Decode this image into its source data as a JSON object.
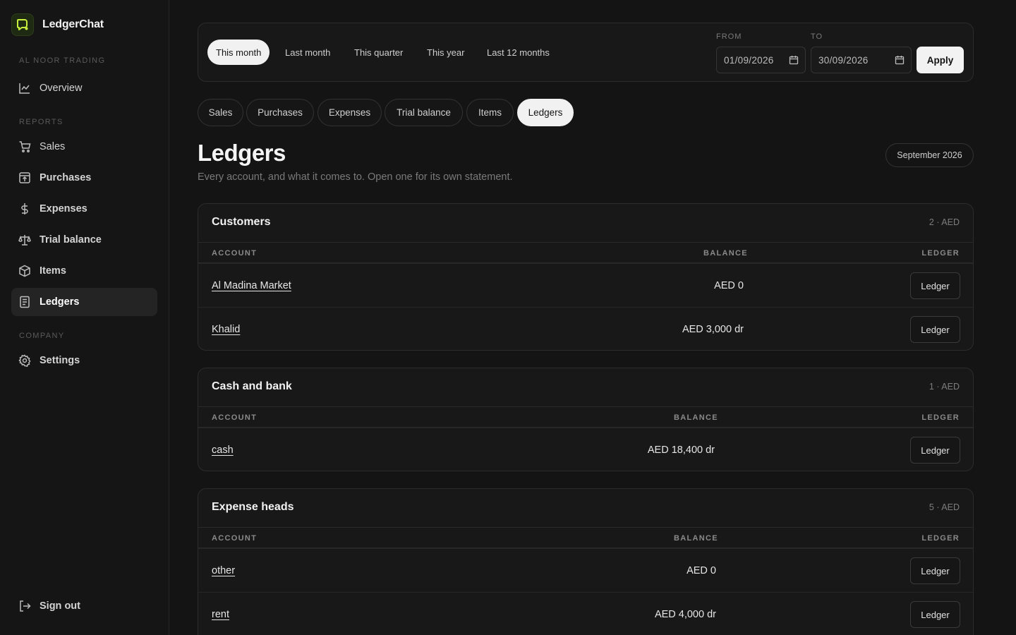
{
  "brand": {
    "name": "LedgerChat"
  },
  "sidebar": {
    "company_label": "AL NOOR TRADING",
    "overview_label": "Overview",
    "reports_label": "REPORTS",
    "reports": [
      {
        "label": "Sales",
        "icon": "cart-icon"
      },
      {
        "label": "Purchases",
        "icon": "box-arrow-icon"
      },
      {
        "label": "Expenses",
        "icon": "dollar-icon"
      },
      {
        "label": "Trial balance",
        "icon": "scale-icon"
      },
      {
        "label": "Items",
        "icon": "cube-icon"
      },
      {
        "label": "Ledgers",
        "icon": "ledger-book-icon",
        "active": true
      }
    ],
    "company_section_label": "COMPANY",
    "settings_label": "Settings",
    "signout_label": "Sign out"
  },
  "filters": {
    "ranges": [
      "This month",
      "Last month",
      "This quarter",
      "This year",
      "Last 12 months"
    ],
    "active_range": "This month",
    "from_label": "FROM",
    "from_value": "01/09/2026",
    "to_label": "TO",
    "to_value": "30/09/2026",
    "apply_label": "Apply"
  },
  "tabs": [
    "Sales",
    "Purchases",
    "Expenses",
    "Trial balance",
    "Items",
    "Ledgers"
  ],
  "active_tab": "Ledgers",
  "page": {
    "title": "Ledgers",
    "subtitle": "Every account, and what it comes to. Open one for its own statement.",
    "period": "September 2026"
  },
  "columns": {
    "account": "ACCOUNT",
    "balance": "BALANCE",
    "ledger": "LEDGER"
  },
  "groups": [
    {
      "title": "Customers",
      "meta": "2 · AED",
      "rows": [
        {
          "account": "Al Madina Market",
          "balance": "AED 0",
          "action": "Ledger"
        },
        {
          "account": "Khalid",
          "balance": "AED 3,000 dr",
          "action": "Ledger"
        }
      ]
    },
    {
      "title": "Cash and bank",
      "meta": "1 · AED",
      "rows": [
        {
          "account": "cash",
          "balance": "AED 18,400 dr",
          "action": "Ledger"
        }
      ]
    },
    {
      "title": "Expense heads",
      "meta": "5 · AED",
      "rows": [
        {
          "account": "other",
          "balance": "AED 0",
          "action": "Ledger"
        },
        {
          "account": "rent",
          "balance": "AED 4,000 dr",
          "action": "Ledger"
        }
      ]
    }
  ],
  "colors": {
    "accent": "#c6f03c",
    "background": "#141414",
    "active_pill": "#f1f1f1"
  }
}
